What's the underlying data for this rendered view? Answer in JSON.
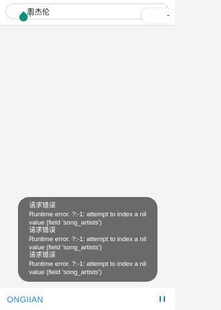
{
  "search": {
    "value": "周杰伦"
  },
  "toast": {
    "messages": [
      {
        "title": "请求错误",
        "body": "Runtime error. ?:-1: attempt to index a nil value (field 'song_artists')"
      },
      {
        "title": "请求错误",
        "body": "Runtime error. ?:-1: attempt to index a nil value (field 'song_artists')"
      },
      {
        "title": "请求错误",
        "body": "Runtime error. ?:-1: attempt to index a nil value (field 'song_artists')"
      }
    ]
  },
  "player": {
    "now_playing": "ONGIIAN",
    "control_icon": "pause-icon"
  },
  "colors": {
    "accent": "#1e88e5",
    "caret": "#0a8f7a",
    "toast_bg": "#6a6a6a"
  }
}
